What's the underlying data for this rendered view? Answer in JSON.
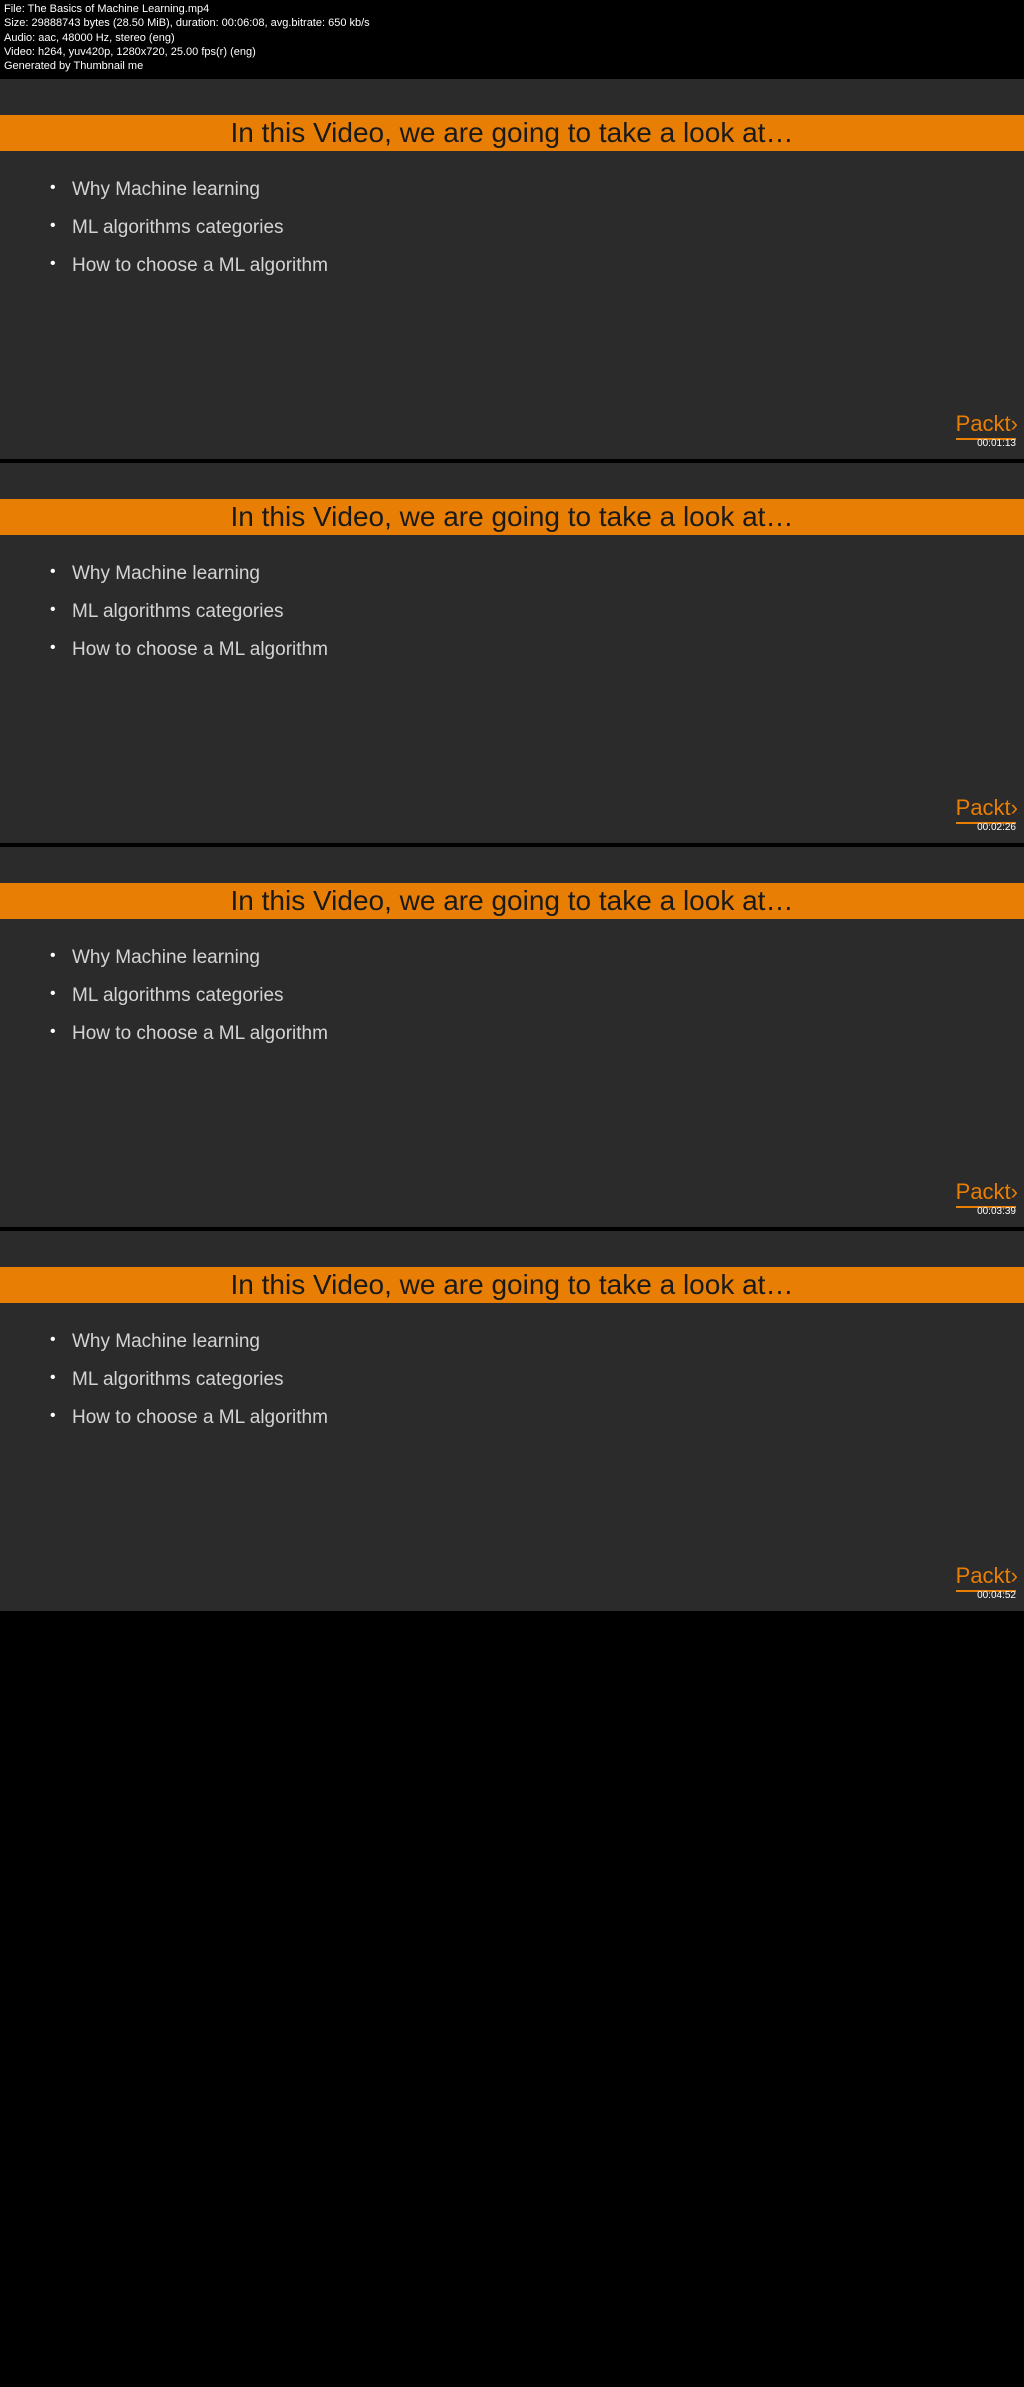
{
  "file_info": {
    "line1": "File: The Basics of Machine Learning.mp4",
    "line2": "Size: 29888743 bytes (28.50 MiB), duration: 00:06:08, avg.bitrate: 650 kb/s",
    "line3": "Audio: aac, 48000 Hz, stereo (eng)",
    "line4": "Video: h264, yuv420p, 1280x720, 25.00 fps(r) (eng)",
    "line5": "Generated by Thumbnail me"
  },
  "slide": {
    "title": "In this Video, we are going to take a look at…",
    "bullets": [
      "Why Machine learning",
      "ML algorithms categories",
      "How to choose a ML algorithm"
    ]
  },
  "logo": "Packt",
  "logo_bracket": "›",
  "thumbs": [
    {
      "timestamp": "00:01:13"
    },
    {
      "timestamp": "00:02:26"
    },
    {
      "timestamp": "00:03:39"
    },
    {
      "timestamp": "00:04:52"
    }
  ]
}
